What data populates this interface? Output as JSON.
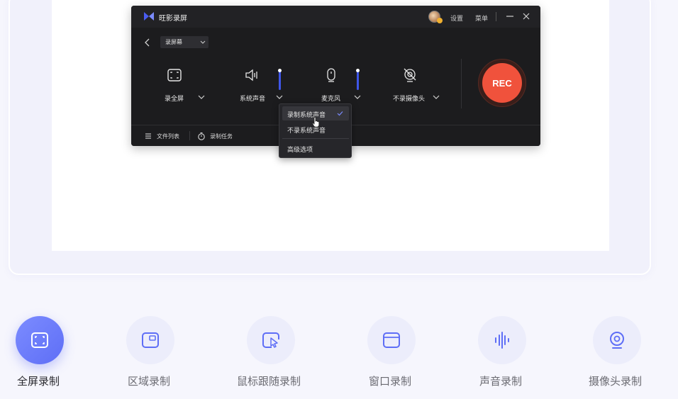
{
  "app": {
    "title": "旺影录屏",
    "settings_label": "设置",
    "menu_label": "菜单",
    "mode_select": "录屏幕"
  },
  "controls": {
    "screen_label": "录全屏",
    "system_audio_label": "系统声音",
    "mic_label": "麦克风",
    "camera_label": "不录摄像头",
    "rec_label": "REC"
  },
  "footer": {
    "file_list": "文件列表",
    "record_task": "录制任务"
  },
  "audio_menu": {
    "items": [
      "录制系统声音",
      "不录系统声音",
      "高级选项"
    ],
    "selected": "录制系统声音"
  },
  "mode_tabs": [
    {
      "label": "全屏录制",
      "icon": "fullscreen-icon",
      "active": true
    },
    {
      "label": "区域录制",
      "icon": "region-icon",
      "active": false
    },
    {
      "label": "鼠标跟随录制",
      "icon": "mouse-follow-icon",
      "active": false
    },
    {
      "label": "窗口录制",
      "icon": "window-icon",
      "active": false
    },
    {
      "label": "声音录制",
      "icon": "audio-wave-icon",
      "active": false
    },
    {
      "label": "摄像头录制",
      "icon": "webcam-icon",
      "active": false
    }
  ],
  "colors": {
    "accent": "#5e6ef6",
    "rec": "#f0523c",
    "app_bg": "#1c1c1e",
    "slider": "#3f56e8"
  }
}
